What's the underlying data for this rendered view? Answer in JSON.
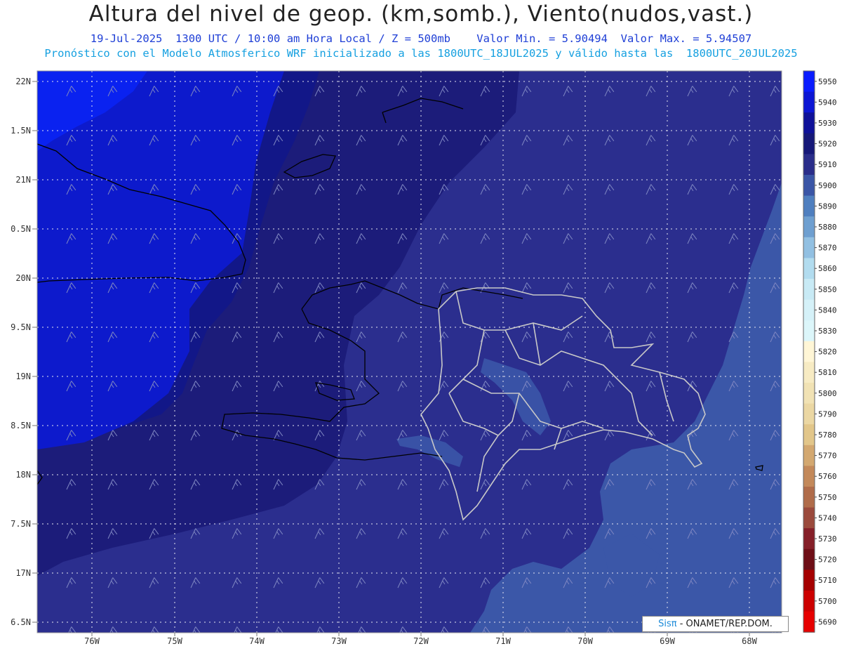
{
  "header": {
    "title": "Altura del nivel de geop. (km,somb.), Viento(nudos,vast.)",
    "subtitle": "19-Jul-2025  1300 UTC / 10:00 am Hora Local / Z = 500mb    Valor Min. = 5.90494  Valor Max. = 5.94507",
    "subtitle2": "Pronóstico con el Modelo Atmosferico WRF inicializado a las 1800UTC_18JUL2025 y válido hasta las  1800UTC_20JUL2025"
  },
  "map": {
    "lat_labels": [
      "22N",
      "1.5N",
      "21N",
      "0.5N",
      "20N",
      "9.5N",
      "19N",
      "8.5N",
      "18N",
      "7.5N",
      "17N",
      "6.5N"
    ],
    "lon_labels": [
      "76W",
      "75W",
      "74W",
      "73W",
      "72W",
      "71W",
      "70W",
      "69W",
      "68W"
    ],
    "field_colors": {
      "5950": "#0a22f0",
      "5940": "#0d1acc",
      "5930": "#121788",
      "5920": "#1c1c7a",
      "5910": "#2b2e8e",
      "5900": "#3b57a8"
    },
    "coastline_color": "#000000",
    "province_border_color": "#c8c8c8"
  },
  "colorbar": {
    "levels": [
      "5950",
      "5940",
      "5930",
      "5920",
      "5910",
      "5900",
      "5890",
      "5880",
      "5870",
      "5860",
      "5850",
      "5840",
      "5830",
      "5820",
      "5810",
      "5800",
      "5790",
      "5780",
      "5770",
      "5760",
      "5750",
      "5740",
      "5730",
      "5720",
      "5710",
      "5700",
      "5690"
    ],
    "colors": [
      "#0a1cff",
      "#0c16d4",
      "#0f1199",
      "#161878",
      "#2a2d8a",
      "#3a55a6",
      "#4f7fbf",
      "#6e9fd0",
      "#92c0e2",
      "#b2dcef",
      "#c8eaf5",
      "#d5f1f8",
      "#dcf6fa",
      "#fff6d6",
      "#f7ebc3",
      "#f1e2b4",
      "#ebd7a3",
      "#e2c68a",
      "#d3a870",
      "#c3895a",
      "#b06c4a",
      "#9b4a3c",
      "#851f28",
      "#6e0e16",
      "#a50000",
      "#cc0000",
      "#e60000"
    ]
  },
  "credit": {
    "brand": "Sisπ",
    "text": "- ONAMET/REP.DOM."
  }
}
